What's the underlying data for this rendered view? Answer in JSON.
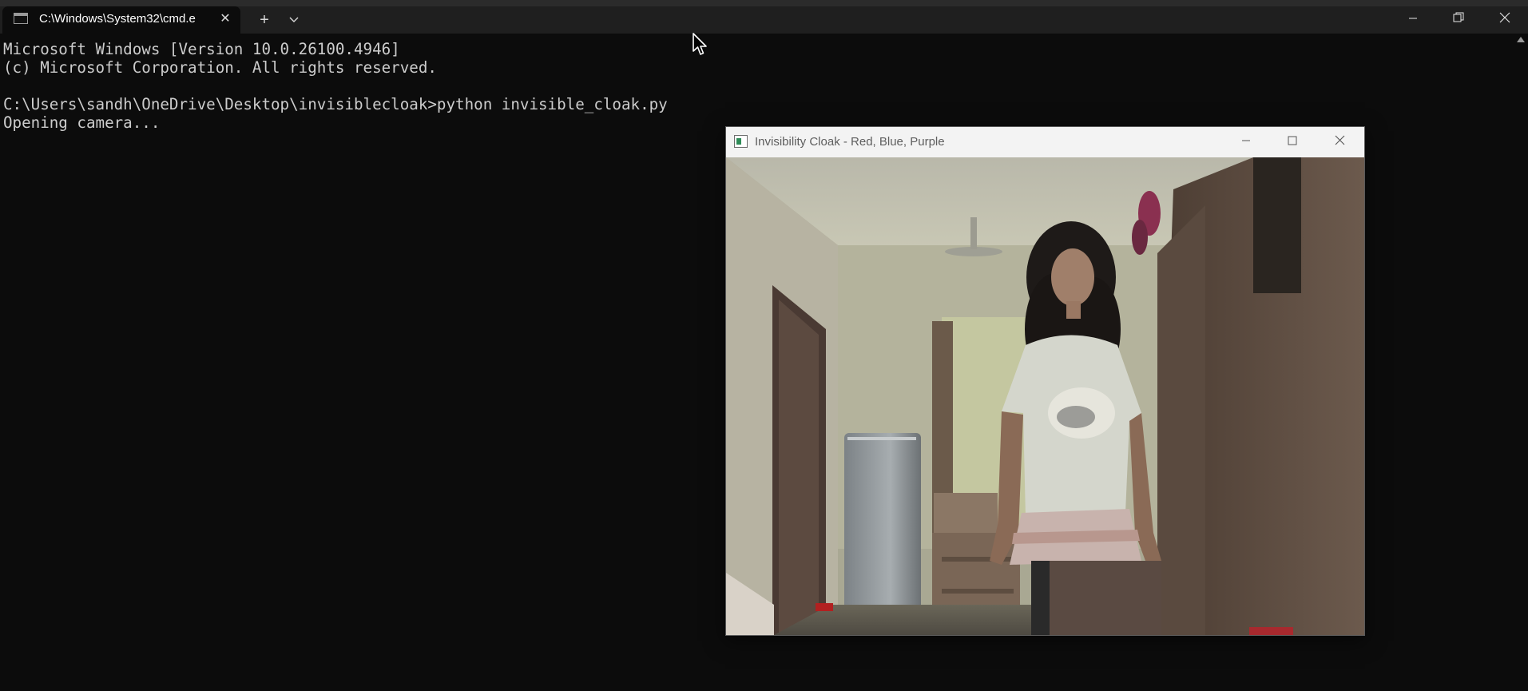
{
  "terminal": {
    "tab_title": "C:\\Windows\\System32\\cmd.e",
    "icons": {
      "tab": "cmd-icon",
      "close": "close-icon",
      "new_tab": "plus-icon",
      "dropdown": "chevron-down-icon",
      "minimize": "minimize-icon",
      "restore": "restore-icon",
      "window_close": "close-icon",
      "scroll": "scroll-up-icon"
    },
    "lines": [
      "Microsoft Windows [Version 10.0.26100.4946]",
      "(c) Microsoft Corporation. All rights reserved.",
      "",
      "C:\\Users\\sandh\\OneDrive\\Desktop\\invisiblecloak>python invisible_cloak.py",
      "Opening camera..."
    ],
    "background": "#0c0c0c",
    "text_color": "#cccccc"
  },
  "camera_window": {
    "title": "Invisibility Cloak - Red, Blue, Purple",
    "icons": {
      "app": "opencv-window-icon",
      "minimize": "minimize-icon",
      "maximize": "maximize-icon",
      "close": "close-icon"
    },
    "content": "webcam-frame"
  }
}
